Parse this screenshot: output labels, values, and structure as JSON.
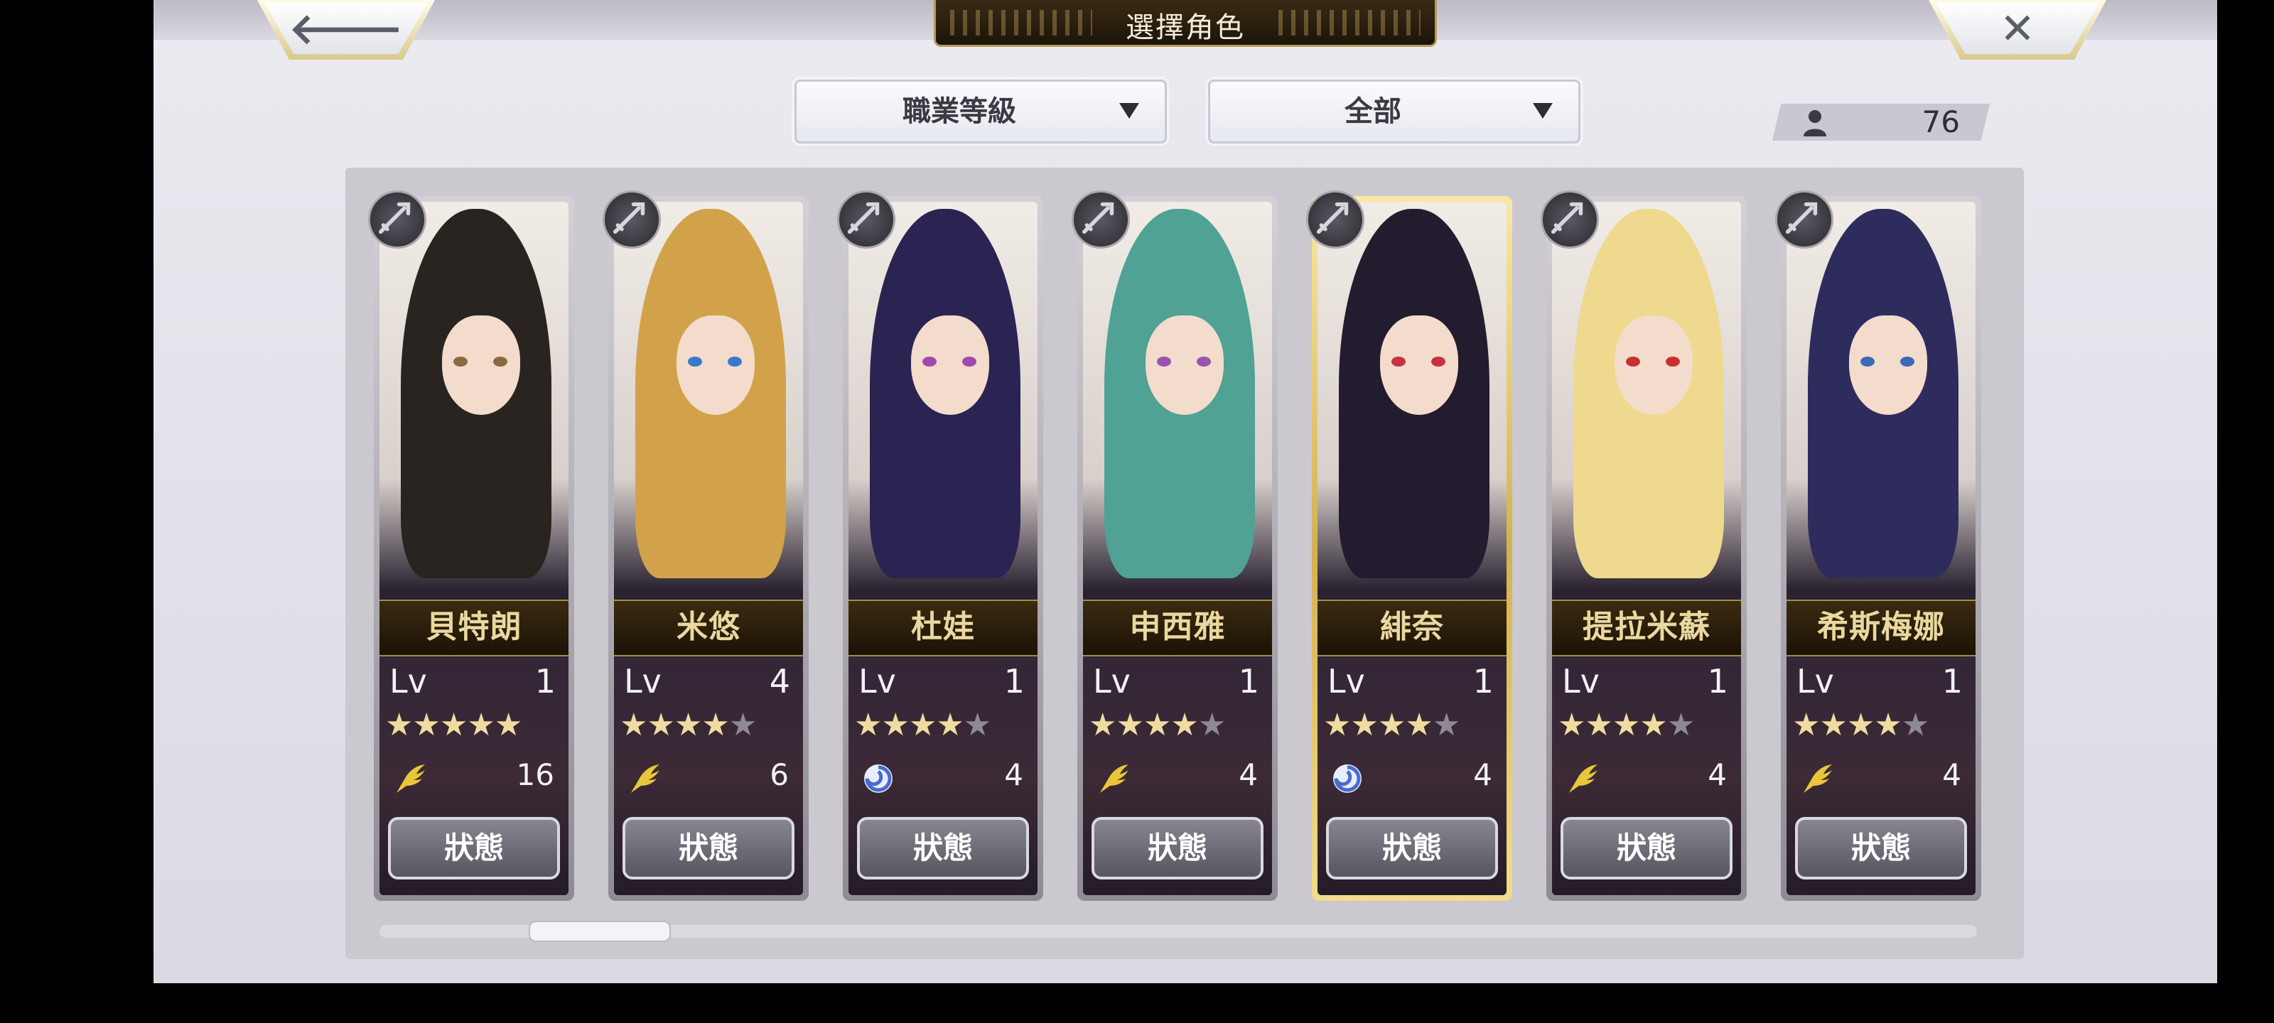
{
  "header": {
    "title": "選擇角色",
    "back_icon": "arrow-left-icon",
    "close_icon": "close-x-icon",
    "back_glyph": "🡐",
    "close_glyph": "✕"
  },
  "filters": {
    "sort_dropdown": "職業等級",
    "filter_dropdown": "全部"
  },
  "unit_count": "76",
  "characters": [
    {
      "name": "貝特朗",
      "lv_label": "Lv",
      "level": "1",
      "stars": 5,
      "max_stars": 5,
      "type": "wing",
      "type_value": "16",
      "status_label": "狀態",
      "weapon": "spear",
      "selected": false,
      "hair": "#2a2420",
      "eyes": "#8a6a40"
    },
    {
      "name": "米悠",
      "lv_label": "Lv",
      "level": "4",
      "stars": 4,
      "max_stars": 5,
      "type": "wing",
      "type_value": "6",
      "status_label": "狀態",
      "weapon": "sword",
      "selected": false,
      "hair": "#d2a24a",
      "eyes": "#3a78c8"
    },
    {
      "name": "杜娃",
      "lv_label": "Lv",
      "level": "1",
      "stars": 4,
      "max_stars": 5,
      "type": "swirl",
      "type_value": "4",
      "status_label": "狀態",
      "weapon": "staff",
      "selected": false,
      "hair": "#2b2352",
      "eyes": "#a048b0"
    },
    {
      "name": "申西雅",
      "lv_label": "Lv",
      "level": "1",
      "stars": 4,
      "max_stars": 5,
      "type": "wing",
      "type_value": "4",
      "status_label": "狀態",
      "weapon": "sword",
      "selected": false,
      "hair": "#4fa294",
      "eyes": "#9a52b0"
    },
    {
      "name": "緋奈",
      "lv_label": "Lv",
      "level": "1",
      "stars": 4,
      "max_stars": 5,
      "type": "swirl",
      "type_value": "4",
      "status_label": "狀態",
      "weapon": "blade",
      "selected": true,
      "hair": "#231c2e",
      "eyes": "#c83040"
    },
    {
      "name": "提拉米蘇",
      "lv_label": "Lv",
      "level": "1",
      "stars": 4,
      "max_stars": 5,
      "type": "wing",
      "type_value": "4",
      "status_label": "狀態",
      "weapon": "spear",
      "selected": false,
      "hair": "#eed98e",
      "eyes": "#c83030"
    },
    {
      "name": "希斯梅娜",
      "lv_label": "Lv",
      "level": "1",
      "stars": 4,
      "max_stars": 5,
      "type": "wing",
      "type_value": "4",
      "status_label": "狀態",
      "weapon": "spear",
      "selected": false,
      "hair": "#2e2c5c",
      "eyes": "#3a6ab8"
    }
  ],
  "colors": {
    "gold_border": "#d4b14e",
    "name_text": "#ead8a0",
    "star_on": "#f1dca0",
    "star_off": "#8e8a94",
    "wing_icon": "#e8c83a",
    "swirl_icon": "#4a6ad0"
  }
}
